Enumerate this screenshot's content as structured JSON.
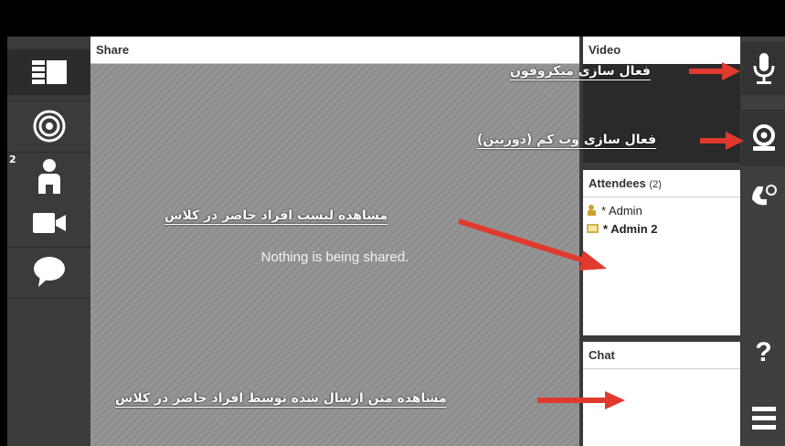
{
  "left_toolbar": {
    "items": [
      {
        "icon": "layout-icon"
      },
      {
        "icon": "target-icon"
      },
      {
        "icon": "attendees-icon",
        "badge": "2"
      },
      {
        "icon": "camera-icon"
      },
      {
        "icon": "chat-bubble-icon"
      }
    ]
  },
  "share": {
    "title": "Share",
    "message": "Nothing is being shared."
  },
  "video": {
    "title": "Video"
  },
  "attendees": {
    "title": "Attendees",
    "count": "(2)",
    "list": [
      {
        "name": "* Admin",
        "bold": false
      },
      {
        "name": "* Admin 2",
        "bold": true
      }
    ]
  },
  "chat": {
    "title": "Chat"
  },
  "right_toolbar": {
    "items": [
      {
        "icon": "microphone-icon"
      },
      {
        "icon": "webcam-icon"
      },
      {
        "icon": "phone-icon"
      },
      {
        "icon": "help-icon",
        "label": "?"
      },
      {
        "icon": "menu-icon"
      }
    ]
  },
  "annotations": {
    "microphone": "فعال سازی میکروفون",
    "webcam": "فعال سازی وب کم (دوربین)",
    "attendees": "مشاهده لیست افراد حاضر در کلاس",
    "chat": "مشاهده متن ارسال شده توسط افراد حاضر در کلاس"
  },
  "colors": {
    "annotation_arrow": "#e03a2f",
    "panel_bg": "#3b3b3b",
    "share_bg": "#8e8e8e"
  }
}
